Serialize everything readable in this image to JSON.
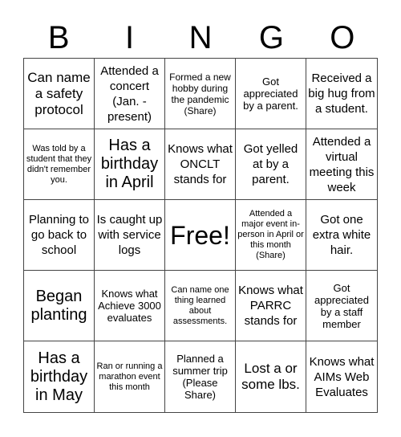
{
  "header": {
    "letters": [
      "B",
      "I",
      "N",
      "G",
      "O"
    ]
  },
  "cells": [
    "Can name a safety protocol",
    "Attended a concert (Jan. - present)",
    "Formed a new hobby during the pandemic (Share)",
    "Got appreciated by a parent.",
    "Received a big hug from a student.",
    "Was told by a student that they didn't remember you.",
    "Has a birthday in April",
    "Knows what ONCLT stands for",
    "Got yelled at by a parent.",
    "Attended a virtual meeting this week",
    "Planning to go back to school",
    "Is caught up with service logs",
    "Free!",
    "Attended a major event in-person in April or this month (Share)",
    "Got one extra white hair.",
    "Began planting",
    "Knows what Achieve 3000 evaluates",
    "Can name one thing learned about assessments.",
    "Knows what PARRC stands for",
    "Got appreciated by a staff member",
    "Has a birthday in May",
    "Ran or running a marathon event this month",
    "Planned a summer trip (Please Share)",
    "Lost a or some lbs.",
    "Knows what AIMs Web Evaluates"
  ]
}
